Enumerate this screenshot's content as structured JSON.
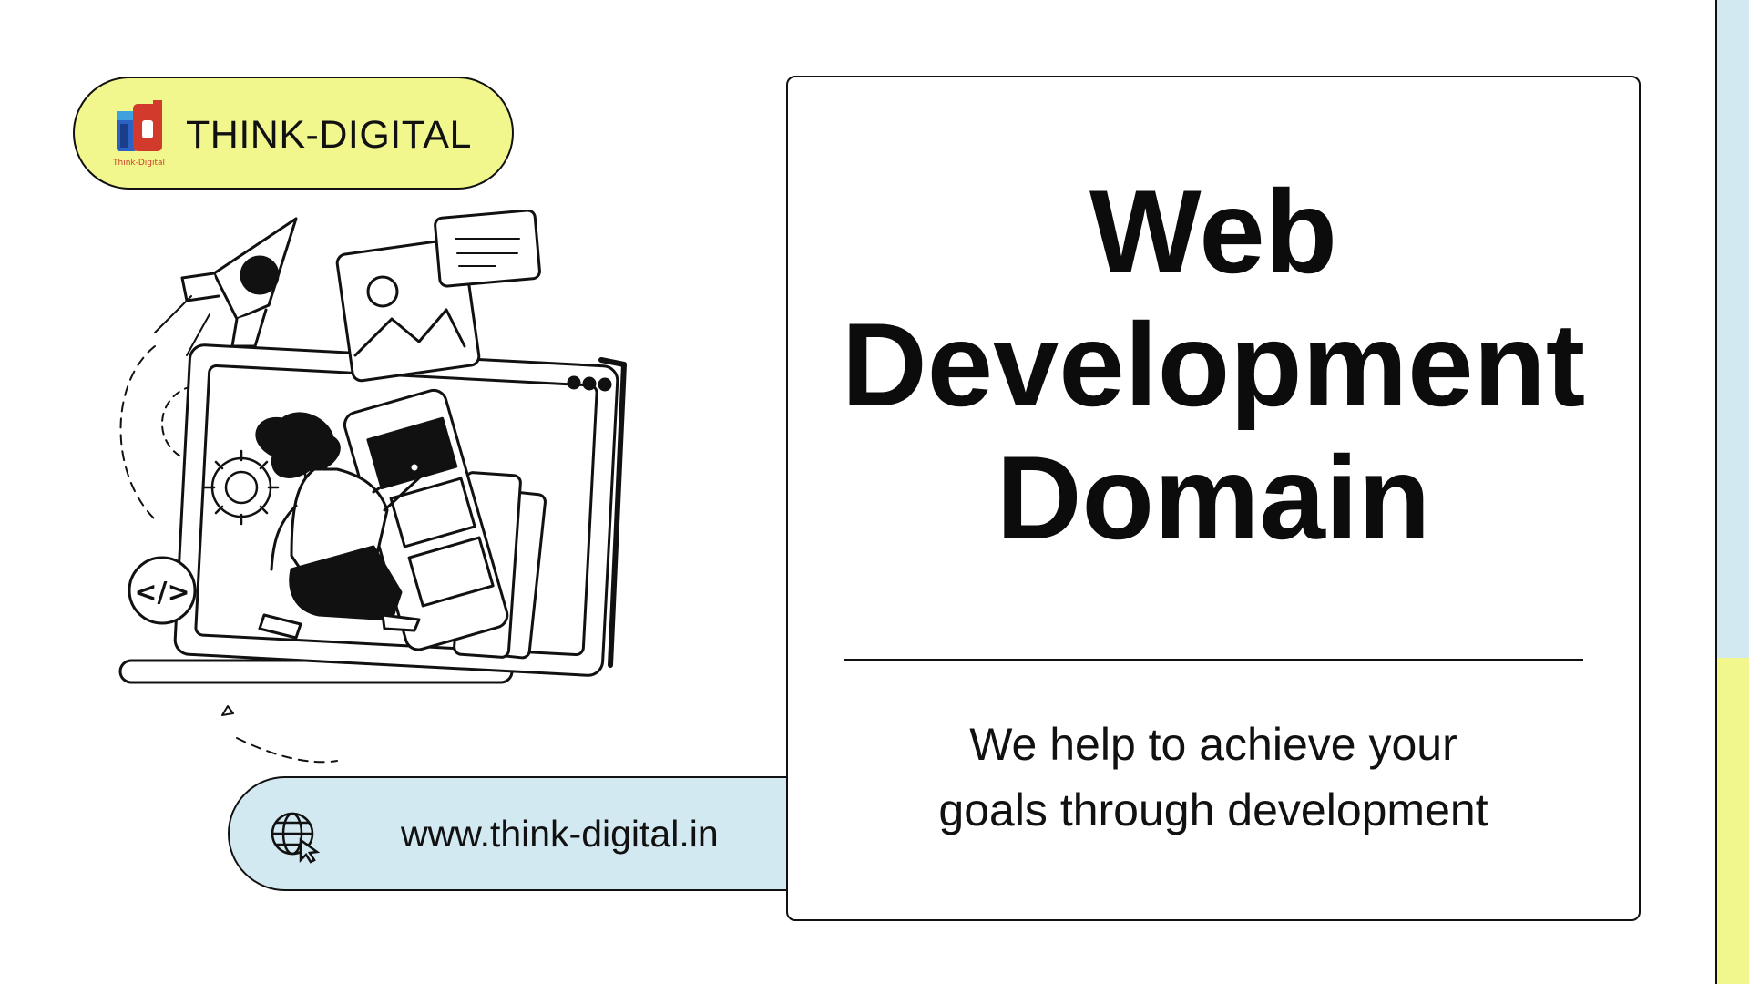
{
  "brand": {
    "name": "THINK-DIGITAL",
    "logo_caption": "Think-Digital",
    "logo_icon": "rd-logo-icon",
    "pill_color": "#f1f78d"
  },
  "illustration": {
    "icon": "web-developer-illustration",
    "code_badge": "</>"
  },
  "website": {
    "icon": "globe-cursor-icon",
    "url": "www.think-digital.in",
    "pill_color": "#d3e9f2"
  },
  "card": {
    "title_lines": [
      "Web",
      "Development",
      "Domain"
    ],
    "tagline_lines": [
      "We help to achieve your",
      "goals through development"
    ]
  },
  "accents": {
    "blue": "#d3e9f2",
    "yellow": "#f1f78d",
    "logo_blue": "#2b62c4",
    "logo_red": "#d23a2b"
  }
}
